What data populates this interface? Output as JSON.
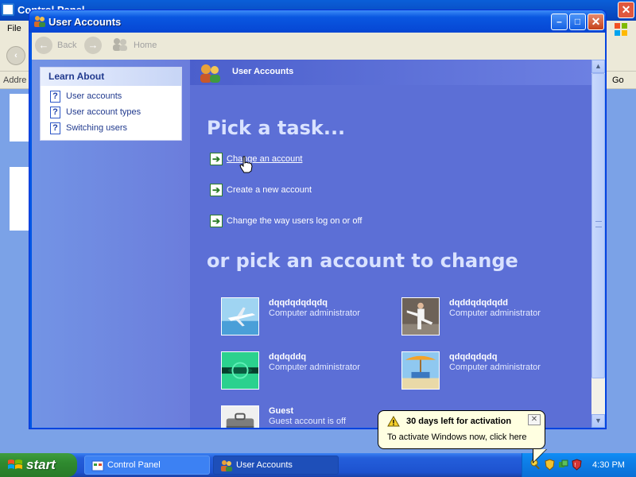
{
  "background_window": {
    "title": "Control Panel",
    "menu_file": "File",
    "address_label": "Addre",
    "go_label": "Go",
    "close_glyph": "✕"
  },
  "window": {
    "title": "User Accounts",
    "min_glyph": "–",
    "max_glyph": "□",
    "close_glyph": "✕"
  },
  "toolbar": {
    "back_label": "Back",
    "home_label": "Home",
    "back_icon": "back-arrow-icon",
    "forward_icon": "forward-arrow-icon"
  },
  "sidebar": {
    "learn_about": {
      "title": "Learn About",
      "items": [
        {
          "label": "User accounts",
          "icon": "help-icon"
        },
        {
          "label": "User account types",
          "icon": "help-icon"
        },
        {
          "label": "Switching users",
          "icon": "help-icon"
        }
      ]
    }
  },
  "main": {
    "header_title": "User Accounts",
    "pick_task_heading": "Pick a task...",
    "tasks": [
      {
        "label": "Change an account"
      },
      {
        "label": "Create a new account"
      },
      {
        "label": "Change the way users log on or off"
      }
    ],
    "pick_account_heading": "or pick an account to change",
    "accounts": [
      {
        "name": "dqqdqdqdqdq",
        "role": "Computer administrator",
        "picture": "airplane"
      },
      {
        "name": "dqddqdqdqdd",
        "role": "Computer administrator",
        "picture": "karate"
      },
      {
        "name": "dqdqddq",
        "role": "Computer administrator",
        "picture": "green-fish"
      },
      {
        "name": "qdqdqdqdq",
        "role": "Computer administrator",
        "picture": "beach-chair"
      },
      {
        "name": "Guest",
        "role": "Guest account is off",
        "picture": "suitcase"
      }
    ]
  },
  "taskbar": {
    "start_label": "start",
    "buttons": [
      {
        "label": "Control Panel",
        "active": false
      },
      {
        "label": "User Accounts",
        "active": true
      }
    ],
    "clock": "4:30 PM"
  },
  "balloon": {
    "title": "30 days left for activation",
    "text": "To activate Windows now, click here",
    "close_glyph": "✕"
  }
}
